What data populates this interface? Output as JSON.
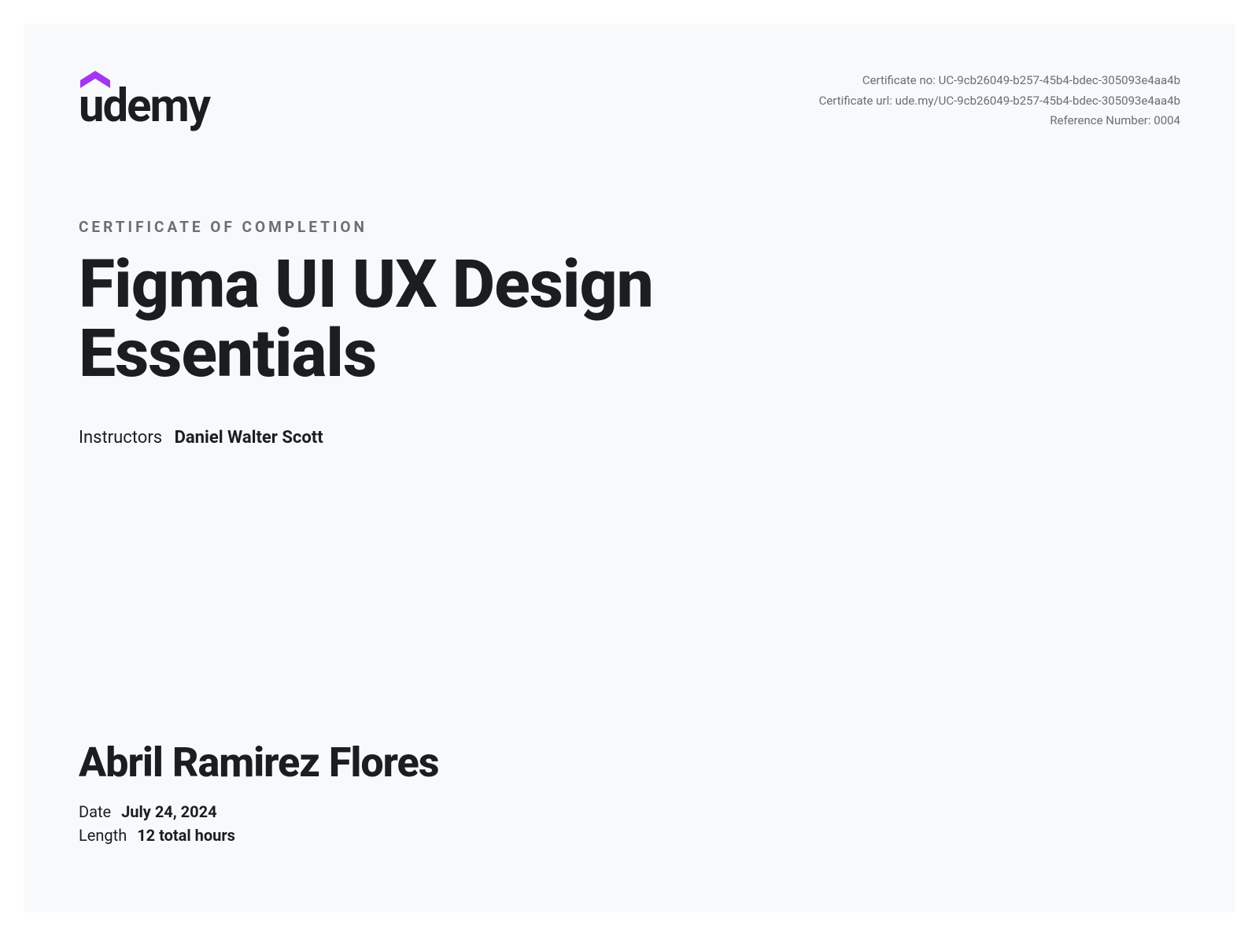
{
  "brand": {
    "name": "udemy"
  },
  "meta": {
    "cert_no_label": "Certificate no:",
    "cert_no_value": "UC-9cb26049-b257-45b4-bdec-305093e4aa4b",
    "cert_url_label": "Certificate url:",
    "cert_url_value": "ude.my/UC-9cb26049-b257-45b4-bdec-305093e4aa4b",
    "ref_label": "Reference Number:",
    "ref_value": "0004"
  },
  "doc_label": "CERTIFICATE OF COMPLETION",
  "course_title": "Figma UI UX Design Essentials",
  "instructors": {
    "label": "Instructors",
    "value": "Daniel Walter Scott"
  },
  "recipient": "Abril Ramirez Flores",
  "date": {
    "label": "Date",
    "value": "July 24, 2024"
  },
  "length": {
    "label": "Length",
    "value": "12 total hours"
  }
}
